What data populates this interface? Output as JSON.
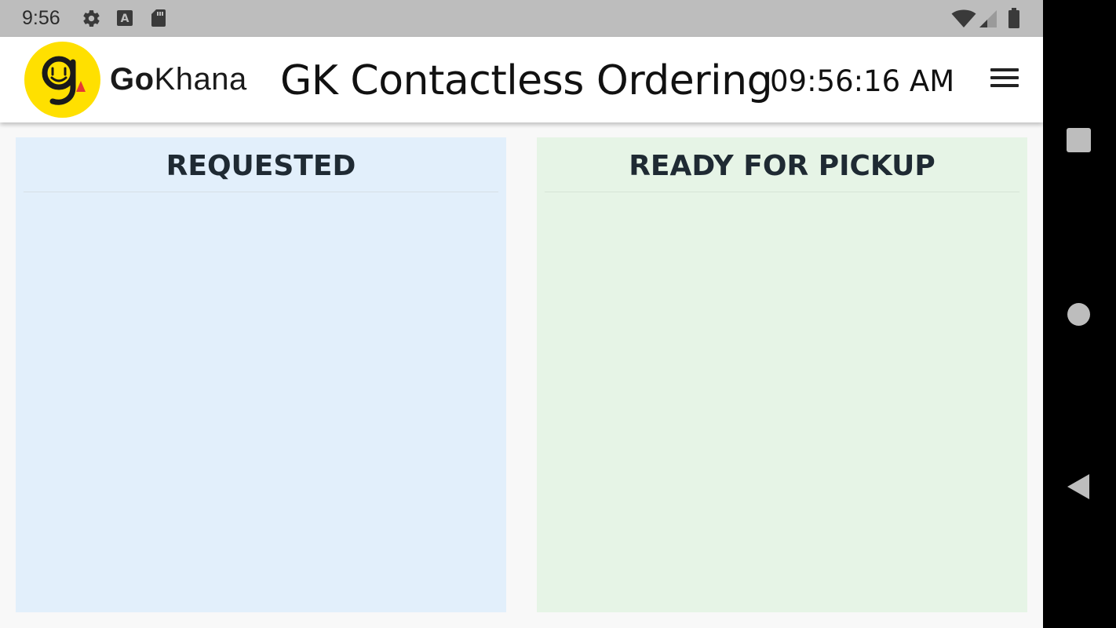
{
  "status_bar": {
    "time": "9:56",
    "icons_left": [
      "settings-icon",
      "font-a-icon",
      "sd-card-icon"
    ],
    "icons_right": [
      "wifi-icon",
      "cell-signal-icon",
      "battery-icon"
    ]
  },
  "app_bar": {
    "brand_prefix": "Go",
    "brand_suffix": "Khana",
    "logo_letter": "g",
    "title": "GK Contactless Ordering",
    "clock": "09:56:16 AM",
    "menu_icon": "hamburger-menu-icon"
  },
  "panels": [
    {
      "title": "REQUESTED",
      "color": "#e2effb",
      "orders": []
    },
    {
      "title": "READY FOR PICKUP",
      "color": "#e6f4e6",
      "orders": []
    }
  ],
  "nav_bar": {
    "buttons": [
      "recent-apps-icon",
      "home-icon",
      "back-icon"
    ]
  },
  "colors": {
    "logo_yellow": "#ffe000",
    "logo_accent": "#e53935",
    "status_bar_bg": "#bdbdbd"
  }
}
